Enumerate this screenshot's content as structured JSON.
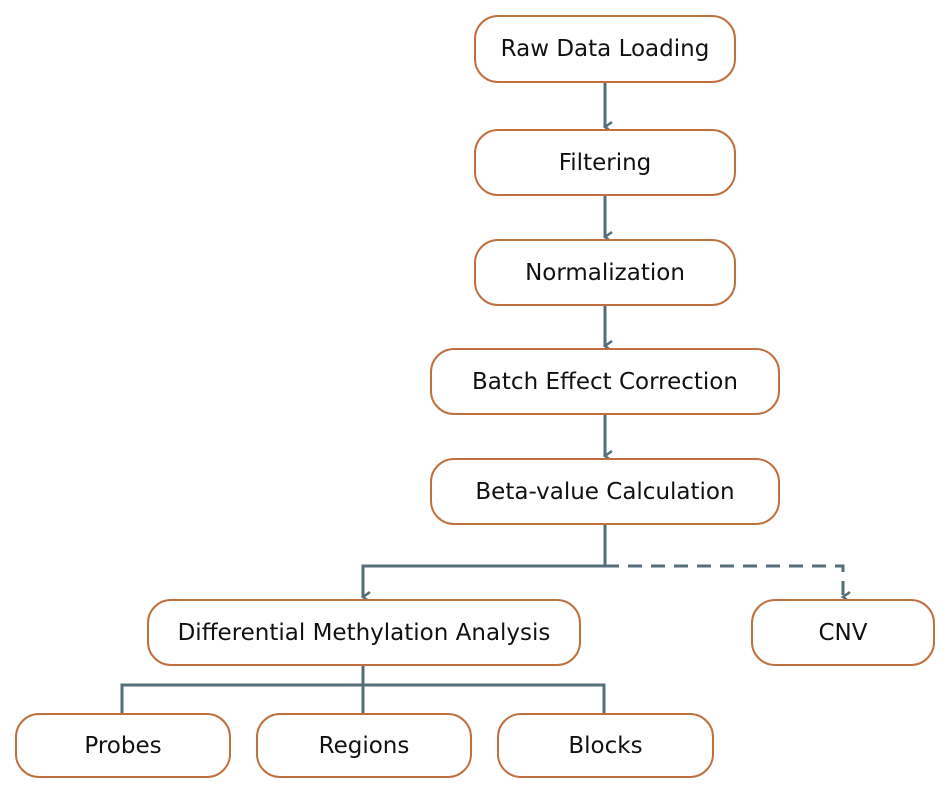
{
  "colors": {
    "node_border": "#C0703F",
    "connector": "#546E7A"
  },
  "nodes": {
    "raw": "Raw Data Loading",
    "filtering": "Filtering",
    "normalization": "Normalization",
    "batch": "Batch Effect Correction",
    "beta": "Beta-value Calculation",
    "dma": "Differential Methylation Analysis",
    "cnv": "CNV",
    "probes": "Probes",
    "regions": "Regions",
    "blocks": "Blocks"
  }
}
